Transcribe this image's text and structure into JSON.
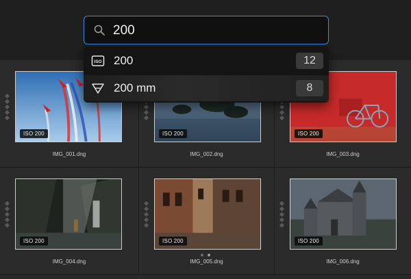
{
  "search": {
    "value": "200"
  },
  "suggestions": [
    {
      "icon": "iso-icon",
      "label": "200",
      "count": "12"
    },
    {
      "icon": "aperture-triangle-icon",
      "label": "200 mm",
      "count": "8"
    }
  ],
  "photos": [
    {
      "file": "IMG_001.dng",
      "badge": "ISO 200"
    },
    {
      "file": "IMG_002.dng",
      "badge": "ISO 200"
    },
    {
      "file": "IMG_003.dng",
      "badge": "ISO 200"
    },
    {
      "file": "IMG_004.dng",
      "badge": "ISO 200"
    },
    {
      "file": "IMG_005.dng",
      "badge": "ISO 200"
    },
    {
      "file": "IMG_006.dng",
      "badge": "ISO 200"
    }
  ],
  "colors": {
    "accent": "#3c8be0",
    "background": "#2a2a2a"
  }
}
